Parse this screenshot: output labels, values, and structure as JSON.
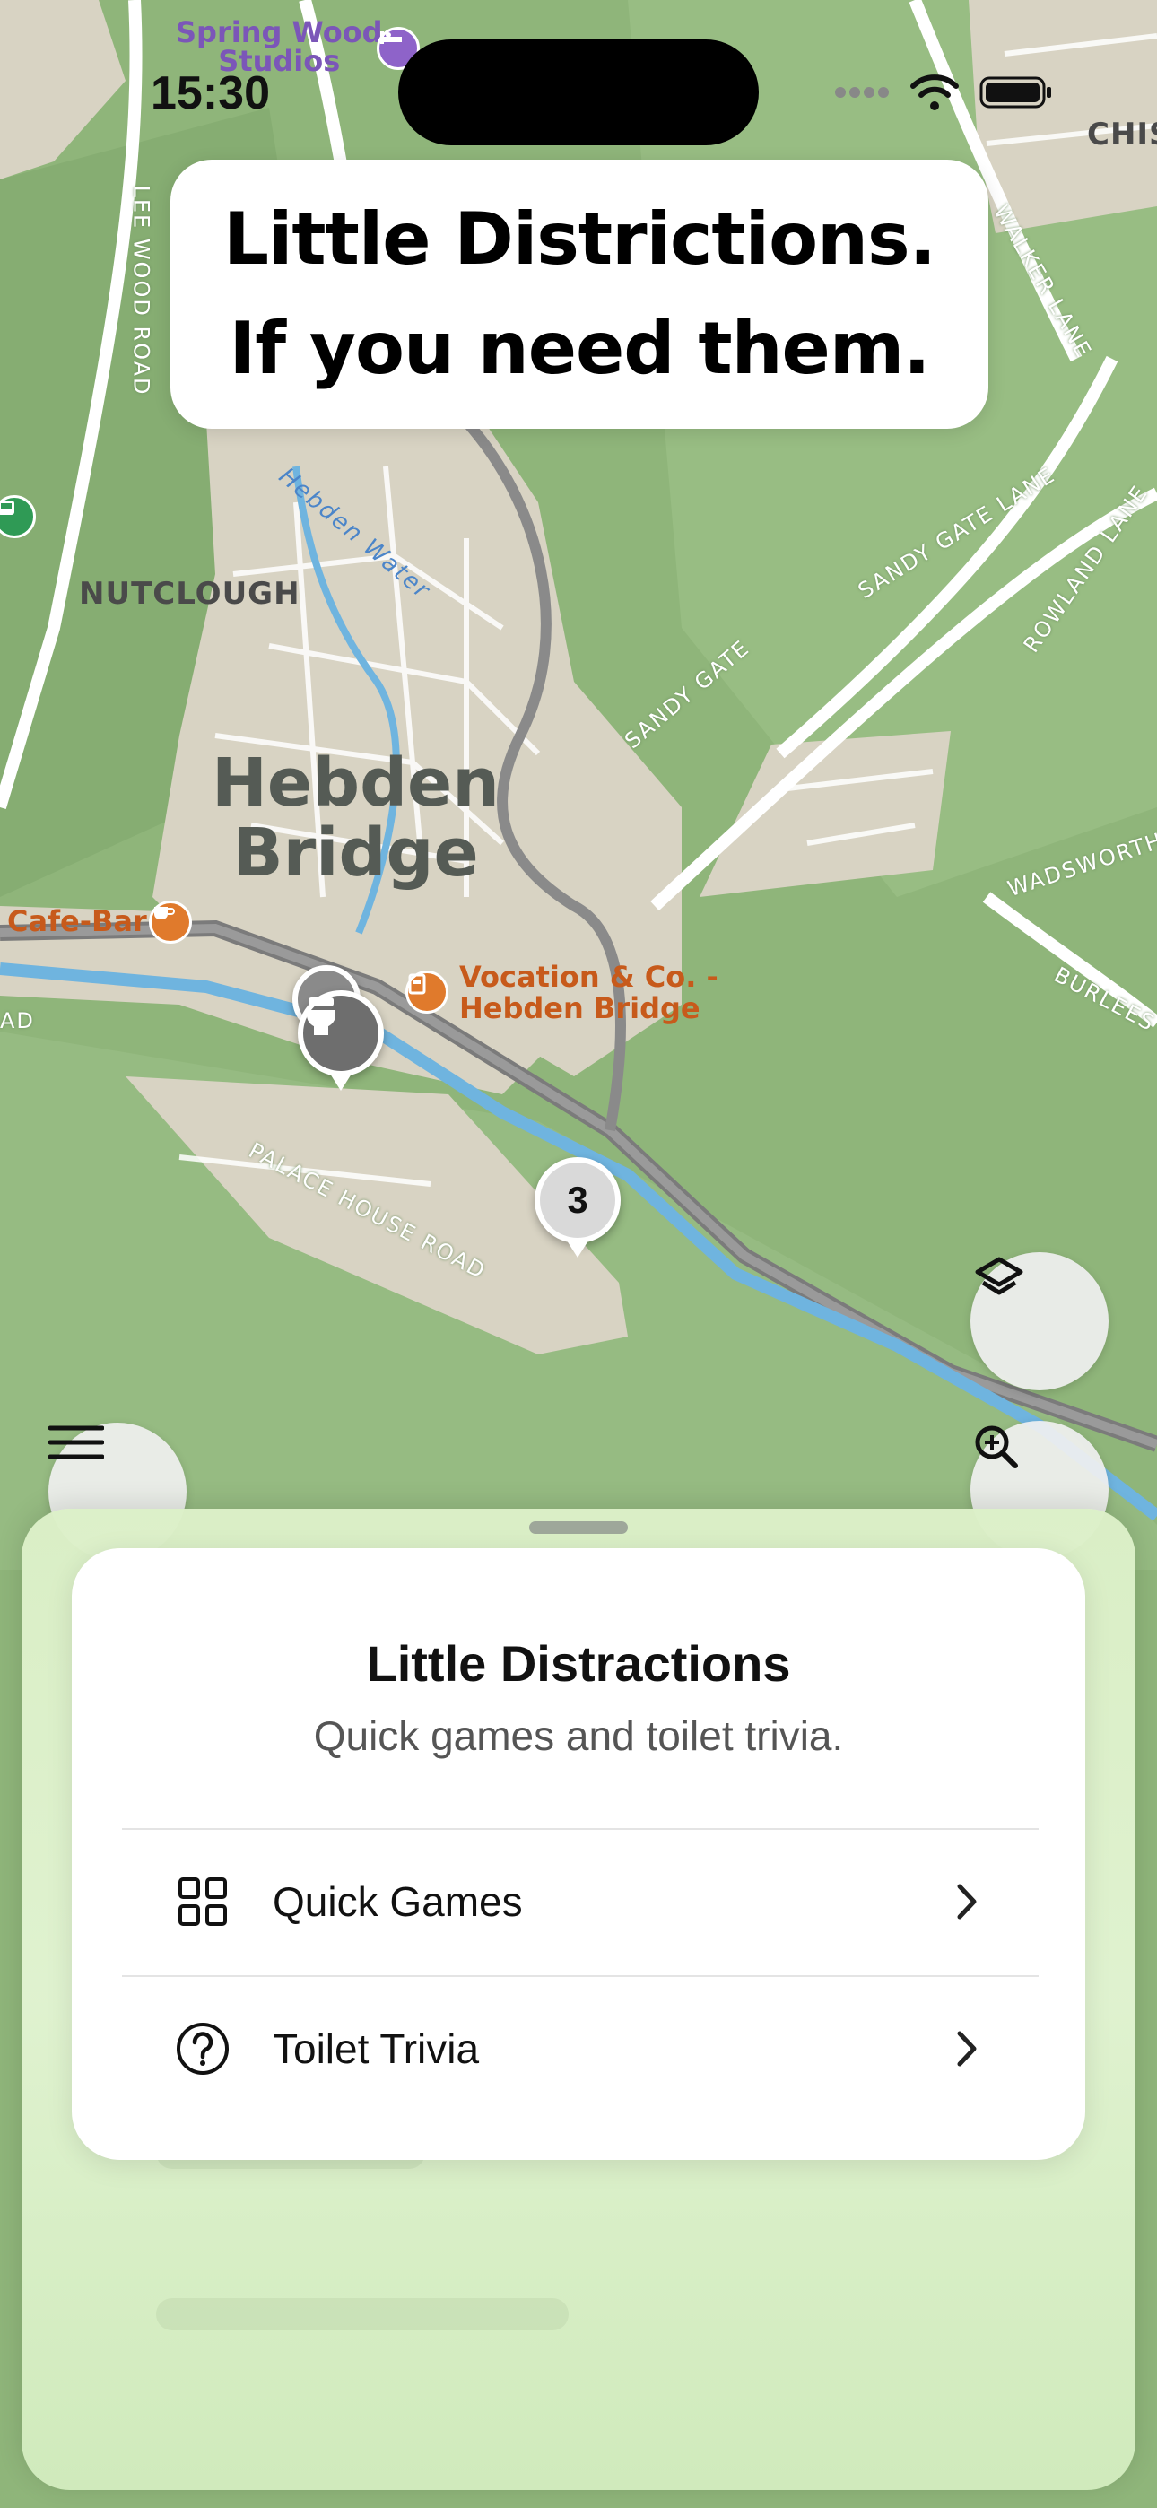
{
  "status_bar": {
    "time": "15:30"
  },
  "banner": {
    "line1": "Little Districtions.",
    "line2": "If you need them."
  },
  "map": {
    "town_line1": "Hebden",
    "town_line2": "Bridge",
    "area_labels": [
      "NUTCLOUGH",
      "CHIS"
    ],
    "road_labels": [
      "LEE WOOD ROAD",
      "WALKER LANE",
      "SANDY GATE LANE",
      "ROWLAND LANE",
      "SANDY GATE",
      "WADSWORTH",
      "BURLEES",
      "PALACE HOUSE ROAD",
      "AD"
    ],
    "water_label": "Hebden Water",
    "poi": {
      "hotel": "Spring Wood\nStudios",
      "hotel_line1": "Spring Wood",
      "hotel_line2": "Studios",
      "cafe": "Cafe-Bar",
      "shop_line1": "Vocation & Co. -",
      "shop_line2": "Hebden Bridge"
    },
    "cluster_count": "3",
    "icons": {
      "toilet_pin": "toilet-icon",
      "layers": "layers-icon",
      "zoom": "zoom-in-icon",
      "menu": "menu-icon"
    }
  },
  "sheet": {
    "title": "Little Distractions",
    "subtitle": "Quick games and toilet trivia.",
    "items": [
      {
        "label": "Quick Games",
        "icon": "grid-icon"
      },
      {
        "label": "Toilet Trivia",
        "icon": "question-circle-icon"
      }
    ]
  },
  "colors": {
    "map_green": "#8fb57a",
    "town_fill": "#d8d3c3",
    "river": "#6fb4df",
    "sheet_tint": "#dff0cf"
  }
}
